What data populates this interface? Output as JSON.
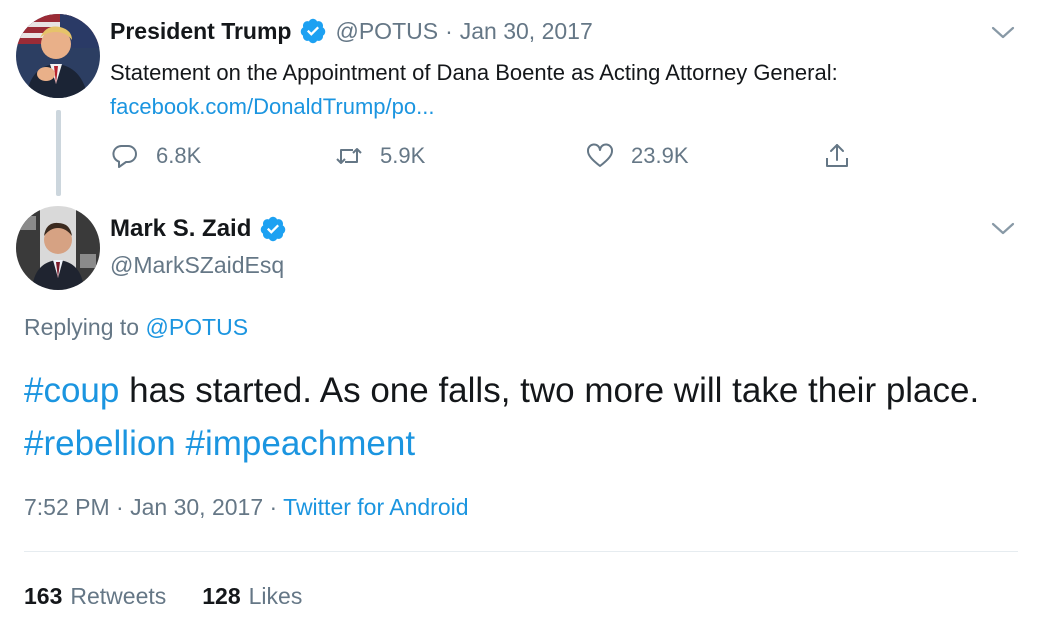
{
  "parent_tweet": {
    "author_name": "President Trump",
    "handle": "@POTUS",
    "separator": "·",
    "date": "Jan 30, 2017",
    "text": "Statement on the Appointment of Dana Boente as Acting Attorney General:",
    "link": "facebook.com/DonaldTrump/po...",
    "actions": {
      "replies": "6.8K",
      "retweets": "5.9K",
      "likes": "23.9K"
    }
  },
  "main_tweet": {
    "author_name": "Mark S. Zaid",
    "handle": "@MarkSZaidEsq",
    "replying_prefix": "Replying to",
    "replying_to": "@POTUS",
    "text": {
      "tag1": "#coup",
      "part1": " has started. As one falls, two more will take their place. ",
      "tag2": "#rebellion",
      "space": " ",
      "tag3": "#impeachment"
    },
    "time": "7:52 PM",
    "meta_separator": "·",
    "date": "Jan 30, 2017",
    "source": "Twitter for Android",
    "stats": {
      "retweets_count": "163",
      "retweets_label": "Retweets",
      "likes_count": "128",
      "likes_label": "Likes"
    }
  },
  "icons": {
    "verified": "verified-badge-icon",
    "chevron": "chevron-down-icon",
    "reply": "reply-icon",
    "retweet": "retweet-icon",
    "like": "heart-icon",
    "share": "share-icon"
  },
  "colors": {
    "link_blue": "#1b95e0",
    "muted_gray": "#657786",
    "text_dark": "#14171a",
    "verified_blue": "#1da1f2",
    "thread_line": "#ccd6dd"
  }
}
